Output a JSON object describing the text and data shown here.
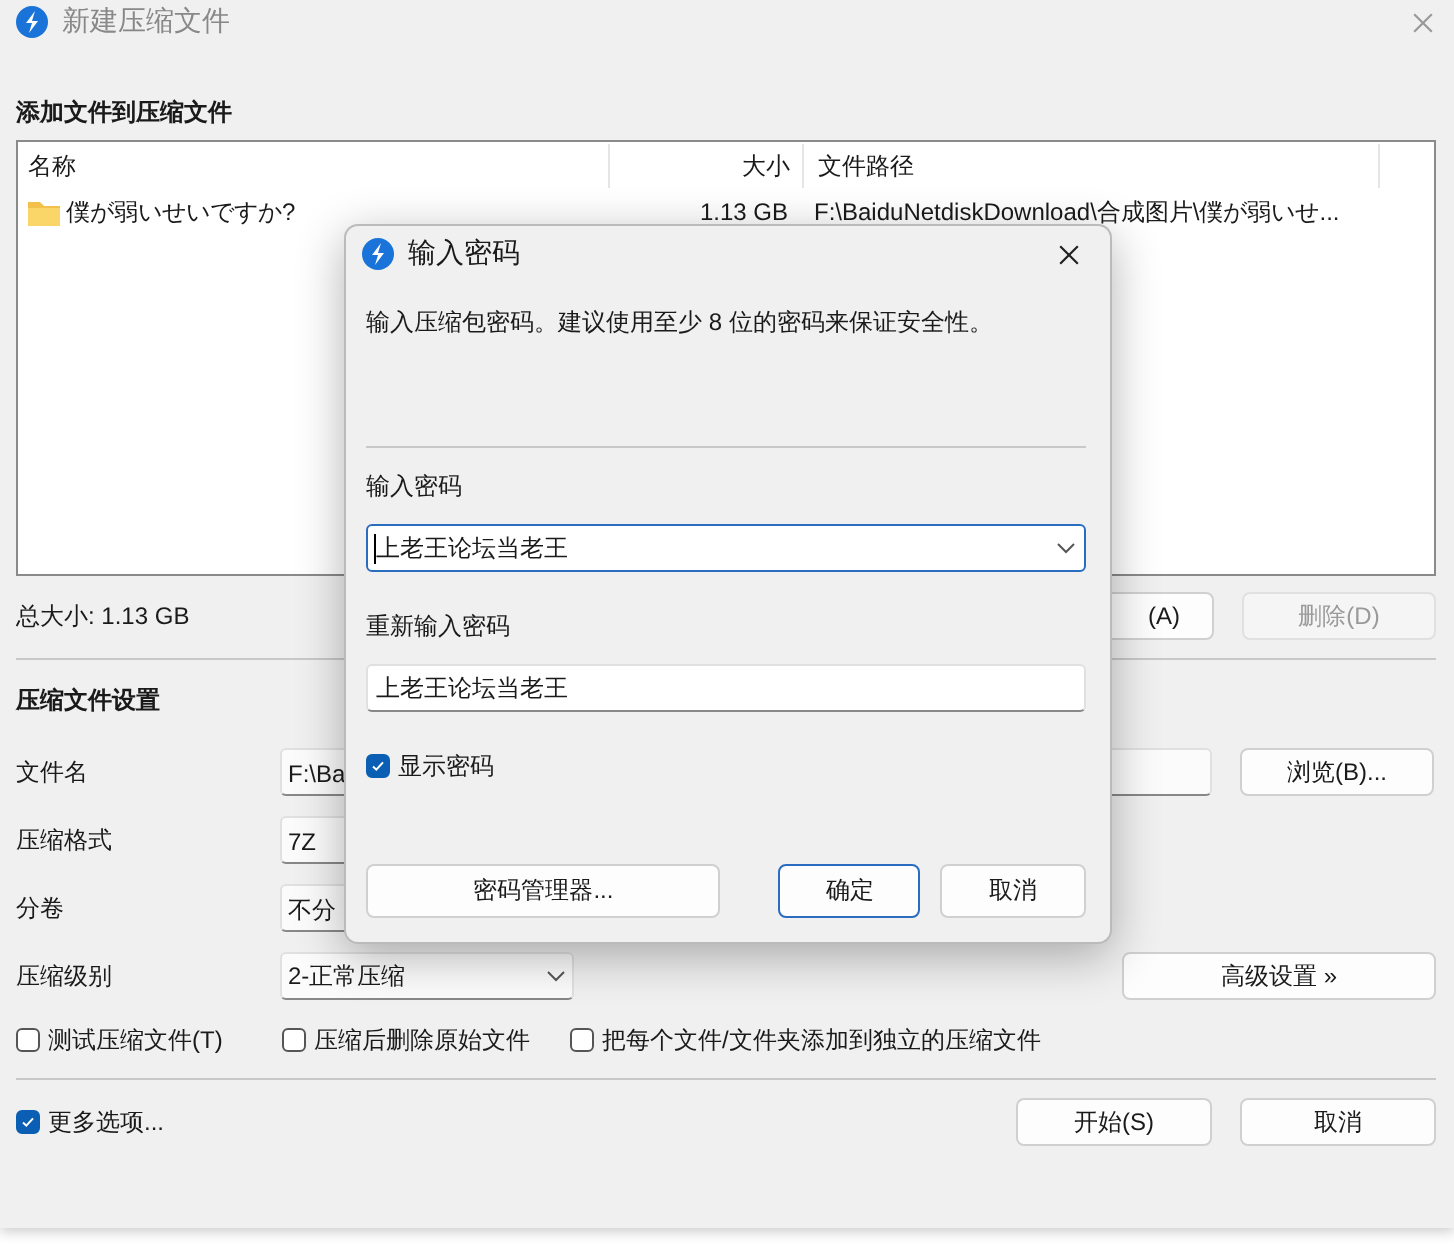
{
  "window": {
    "title": "新建压缩文件",
    "active": false
  },
  "files_section": {
    "heading": "添加文件到压缩文件",
    "columns": [
      "名称",
      "大小",
      "文件路径"
    ],
    "rows": [
      {
        "name": "僕が弱いせいですか?",
        "size": "1.13 GB",
        "path": "F:\\BaiduNetdiskDownload\\合成图片\\僕が弱いせ..."
      }
    ],
    "total": "总大小: 1.13 GB",
    "buttons": [
      {
        "label": "(A)",
        "disabled": false
      },
      {
        "label": "删除(D)",
        "disabled": true
      }
    ]
  },
  "settings": {
    "heading": "压缩文件设置",
    "fields": [
      {
        "label": "文件名",
        "kind": "input",
        "value": "F:\\Ba"
      },
      {
        "label": "压缩格式",
        "kind": "select",
        "value": "7Z"
      },
      {
        "label": "分卷",
        "kind": "select",
        "value": "不分"
      },
      {
        "label": "压缩级别",
        "kind": "dropdown",
        "value": "2-正常压缩"
      }
    ],
    "browse_button": "浏览(B)...",
    "advanced_button": "高级设置 »",
    "options": [
      {
        "label": "测试压缩文件(T)",
        "checked": false
      },
      {
        "label": "压缩后删除原始文件",
        "checked": false
      },
      {
        "label": "把每个文件/文件夹添加到独立的压缩文件",
        "checked": false
      }
    ]
  },
  "footer": {
    "more_options": {
      "label": "更多选项...",
      "checked": true
    },
    "buttons": [
      "开始(S)",
      "取消"
    ]
  },
  "dialog": {
    "title": "输入密码",
    "description": "输入压缩包密码。建议使用至少 8 位的密码来保证安全性。",
    "password_label": "输入密码",
    "password": "上老王论坛当老王",
    "confirm_label": "重新输入密码",
    "confirm": "上老王论坛当老王",
    "show_password": {
      "label": "显示密码",
      "checked": true
    },
    "buttons": [
      {
        "label": "密码管理器...",
        "default": false
      },
      {
        "label": "确定",
        "default": true
      },
      {
        "label": "取消",
        "default": false
      }
    ]
  }
}
